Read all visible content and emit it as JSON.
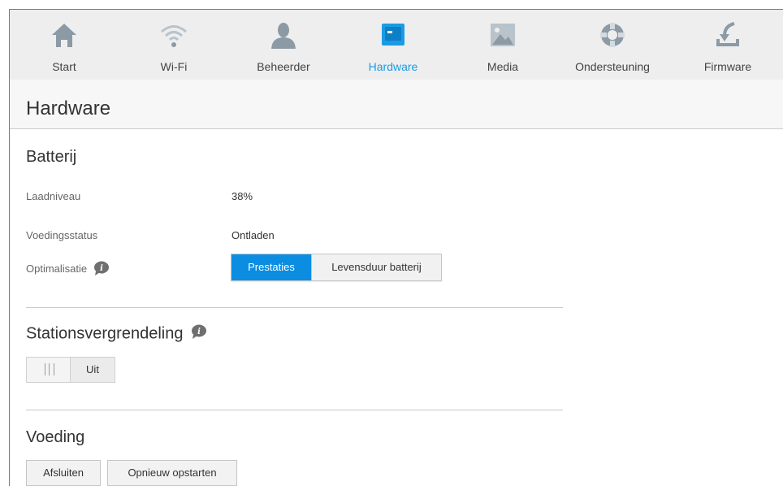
{
  "nav": {
    "items": [
      {
        "label": "Start",
        "icon": "home-icon"
      },
      {
        "label": "Wi-Fi",
        "icon": "wifi-icon"
      },
      {
        "label": "Beheerder",
        "icon": "user-icon"
      },
      {
        "label": "Hardware",
        "icon": "hardware-icon"
      },
      {
        "label": "Media",
        "icon": "media-icon"
      },
      {
        "label": "Ondersteuning",
        "icon": "lifebuoy-icon"
      },
      {
        "label": "Firmware",
        "icon": "firmware-icon"
      }
    ],
    "active": "Hardware",
    "accent_color": "#1a9be4"
  },
  "page": {
    "title": "Hardware"
  },
  "battery": {
    "title": "Batterij",
    "charge_label": "Laadniveau",
    "charge_value": "38%",
    "power_status_label": "Voedingsstatus",
    "power_status_value": "Ontladen",
    "optimization_label": "Optimalisatie",
    "optimization_options": [
      "Prestaties",
      "Levensduur batterij"
    ],
    "optimization_selected": "Prestaties"
  },
  "drive_lock": {
    "title": "Stationsvergrendeling",
    "toggle_state": "Uit"
  },
  "power": {
    "title": "Voeding",
    "shutdown_label": "Afsluiten",
    "restart_label": "Opnieuw opstarten"
  },
  "colors": {
    "selected_button": "#0b8de2",
    "icon_gray": "#8c9aa5"
  }
}
